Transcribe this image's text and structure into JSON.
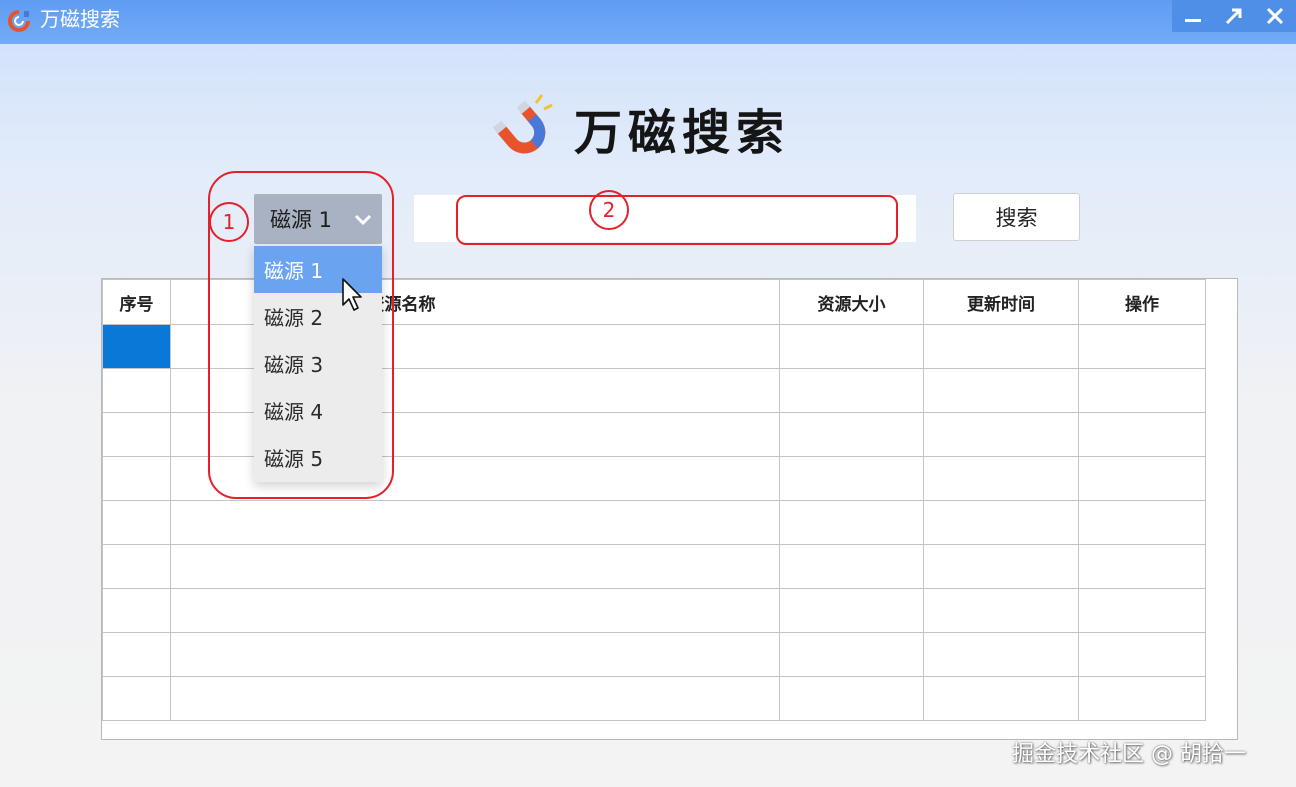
{
  "window": {
    "title": "万磁搜索",
    "controls": {
      "minimize": "minimize-icon",
      "maximize": "maximize-icon",
      "close": "close-icon"
    }
  },
  "header": {
    "logo_text": "万磁搜索",
    "logo_icon": "magnet-icon"
  },
  "source_select": {
    "value": "磁源 1",
    "options": [
      "磁源 1",
      "磁源 2",
      "磁源 3",
      "磁源 4",
      "磁源 5"
    ],
    "selected_index": 0
  },
  "search": {
    "value": "",
    "button_label": "搜索"
  },
  "table": {
    "columns": [
      "序号",
      "",
      "资源名称",
      "资源大小",
      "更新时间",
      "操作"
    ],
    "row_count": 9
  },
  "annotations": {
    "marker_1": "1",
    "marker_2": "2"
  },
  "watermark": "掘金技术社区 @ 胡拾一",
  "colors": {
    "accent": "#6aa4f1",
    "annotation": "#e4202a",
    "titlebar": "#5f9cf2",
    "selected_cell": "#0a78d7"
  }
}
